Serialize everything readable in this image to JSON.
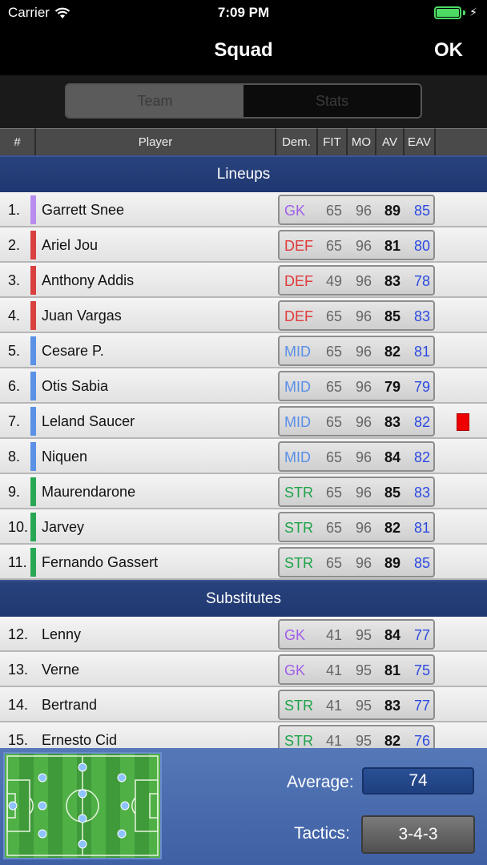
{
  "status_bar": {
    "carrier": "Carrier",
    "time": "7:09 PM"
  },
  "nav": {
    "title": "Squad",
    "ok_label": "OK"
  },
  "segment": {
    "tabs": [
      "Team",
      "Stats"
    ],
    "selected": "Team"
  },
  "columns": {
    "num": "#",
    "player": "Player",
    "dem": "Dem.",
    "fit": "FIT",
    "mo": "MO",
    "av": "AV",
    "eav": "EAV"
  },
  "colors": {
    "GK": "#a15fe8",
    "DEF": "#e03a3a",
    "MID": "#5a8fe8",
    "STR": "#1ea34a",
    "stripe_GK": "#b98cf0",
    "stripe_DEF": "#d94040",
    "stripe_MID": "#5b91e6",
    "stripe_STR": "#28a854",
    "eav": "#2c49e0",
    "section_bg": "#243d77",
    "red_card": "#ee0000"
  },
  "sections": [
    {
      "title": "Lineups",
      "players": [
        {
          "num": "1.",
          "name": "Garrett Snee",
          "pos": "GK",
          "fit": "65",
          "mo": "96",
          "av": "89",
          "eav": "85",
          "stripe": true
        },
        {
          "num": "2.",
          "name": "Ariel Jou",
          "pos": "DEF",
          "fit": "65",
          "mo": "96",
          "av": "81",
          "eav": "80",
          "stripe": true
        },
        {
          "num": "3.",
          "name": "Anthony Addis",
          "pos": "DEF",
          "fit": "49",
          "mo": "96",
          "av": "83",
          "eav": "78",
          "stripe": true
        },
        {
          "num": "4.",
          "name": "Juan Vargas",
          "pos": "DEF",
          "fit": "65",
          "mo": "96",
          "av": "85",
          "eav": "83",
          "stripe": true
        },
        {
          "num": "5.",
          "name": "Cesare P.",
          "pos": "MID",
          "fit": "65",
          "mo": "96",
          "av": "82",
          "eav": "81",
          "stripe": true
        },
        {
          "num": "6.",
          "name": "Otis Sabia",
          "pos": "MID",
          "fit": "65",
          "mo": "96",
          "av": "79",
          "eav": "79",
          "stripe": true
        },
        {
          "num": "7.",
          "name": "Leland Saucer",
          "pos": "MID",
          "fit": "65",
          "mo": "96",
          "av": "83",
          "eav": "82",
          "stripe": true,
          "red_card": true
        },
        {
          "num": "8.",
          "name": "Niquen",
          "pos": "MID",
          "fit": "65",
          "mo": "96",
          "av": "84",
          "eav": "82",
          "stripe": true
        },
        {
          "num": "9.",
          "name": "Maurendarone",
          "pos": "STR",
          "fit": "65",
          "mo": "96",
          "av": "85",
          "eav": "83",
          "stripe": true
        },
        {
          "num": "10.",
          "name": "Jarvey",
          "pos": "STR",
          "fit": "65",
          "mo": "96",
          "av": "82",
          "eav": "81",
          "stripe": true
        },
        {
          "num": "11.",
          "name": "Fernando Gassert",
          "pos": "STR",
          "fit": "65",
          "mo": "96",
          "av": "89",
          "eav": "85",
          "stripe": true
        }
      ]
    },
    {
      "title": "Substitutes",
      "players": [
        {
          "num": "12.",
          "name": "Lenny",
          "pos": "GK",
          "fit": "41",
          "mo": "95",
          "av": "84",
          "eav": "77",
          "stripe": false
        },
        {
          "num": "13.",
          "name": "Verne",
          "pos": "GK",
          "fit": "41",
          "mo": "95",
          "av": "81",
          "eav": "75",
          "stripe": false
        },
        {
          "num": "14.",
          "name": "Bertrand",
          "pos": "STR",
          "fit": "41",
          "mo": "95",
          "av": "83",
          "eav": "77",
          "stripe": false
        },
        {
          "num": "15.",
          "name": "Ernesto Cid",
          "pos": "STR",
          "fit": "41",
          "mo": "95",
          "av": "82",
          "eav": "76",
          "stripe": false
        }
      ]
    }
  ],
  "footer": {
    "average_label": "Average:",
    "average_value": "74",
    "tactics_label": "Tactics:",
    "tactics_value": "3-4-3"
  }
}
